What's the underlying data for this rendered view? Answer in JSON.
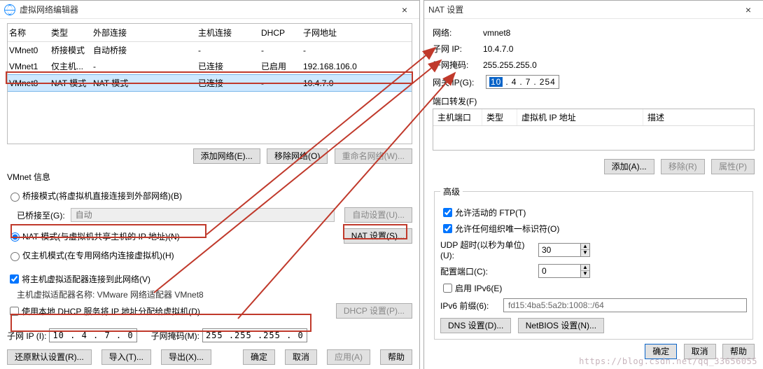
{
  "left": {
    "title": "虚拟网络编辑器",
    "columns": [
      "名称",
      "类型",
      "外部连接",
      "主机连接",
      "DHCP",
      "子网地址"
    ],
    "rows": [
      {
        "name": "VMnet0",
        "type": "桥接模式",
        "ext": "自动桥接",
        "host": "-",
        "dhcp": "-",
        "subnet": "-"
      },
      {
        "name": "VMnet1",
        "type": "仅主机...",
        "ext": "-",
        "host": "已连接",
        "dhcp": "已启用",
        "subnet": "192.168.106.0"
      },
      {
        "name": "VMnet8",
        "type": "NAT 模式",
        "ext": "NAT 模式",
        "host": "已连接",
        "dhcp": "-",
        "subnet": "10.4.7.0"
      }
    ],
    "buttons": {
      "add_net": "添加网络(E)...",
      "remove_net": "移除网络(O)",
      "rename_net": "重命名网络(W)..."
    },
    "info_header": "VMnet 信息",
    "radio_bridge": "桥接模式(将虚拟机直接连接到外部网络)(B)",
    "bridge_to_label": "已桥接至(G):",
    "bridge_to_value": "自动",
    "bridge_auto_btn": "自动设置(U)...",
    "radio_nat": "NAT 模式(与虚拟机共享主机的 IP 地址)(N)",
    "nat_settings_btn": "NAT 设置(S)...",
    "radio_host": "仅主机模式(在专用网络内连接虚拟机)(H)",
    "chk_connect": "将主机虚拟适配器连接到此网络(V)",
    "adapter_label": "主机虚拟适配器名称: VMware 网络适配器 VMnet8",
    "chk_dhcp": "使用本地 DHCP 服务将 IP 地址分配给虚拟机(D)",
    "dhcp_btn": "DHCP 设置(P)...",
    "subnet_ip_label": "子网 IP (I):",
    "subnet_ip": "10 . 4 . 7 . 0",
    "subnet_mask_label": "子网掩码(M):",
    "subnet_mask": "255 .255 .255 . 0",
    "footer": {
      "restore": "还原默认设置(R)...",
      "import": "导入(T)...",
      "export": "导出(X)...",
      "ok": "确定",
      "cancel": "取消",
      "apply": "应用(A)",
      "help": "帮助"
    }
  },
  "right": {
    "title": "NAT 设置",
    "net_label": "网络:",
    "net_val": "vmnet8",
    "sub_ip_label": "子网 IP:",
    "sub_ip_val": "10.4.7.0",
    "mask_label": "子网掩码:",
    "mask_val": "255.255.255.0",
    "gw_label": "网关 IP(G):",
    "gw_oct": [
      "10",
      "4",
      "7",
      "254"
    ],
    "port_fwd_label": "端口转发(F)",
    "pf_cols": {
      "host_port": "主机端口",
      "type": "类型",
      "vm_ip": "虚拟机 IP 地址",
      "desc": "描述"
    },
    "pf_btns": {
      "add": "添加(A)...",
      "remove": "移除(R)",
      "props": "属性(P)"
    },
    "adv_title": "高级",
    "chk_ftp": "允许活动的 FTP(T)",
    "chk_org": "允许任何组织唯一标识符(O)",
    "udp_label": "UDP 超时(以秒为单位)(U):",
    "udp_val": "30",
    "cfg_port_label": "配置端口(C):",
    "cfg_port_val": "0",
    "chk_ipv6": "启用 IPv6(E)",
    "ipv6_prefix_label": "IPv6 前缀(6):",
    "ipv6_prefix_val": "fd15:4ba5:5a2b:1008::/64",
    "dns_btn": "DNS 设置(D)...",
    "netbios_btn": "NetBIOS 设置(N)...",
    "footer": {
      "ok": "确定",
      "cancel": "取消",
      "help": "帮助"
    }
  },
  "watermark": "https://blog.csdn.net/qq_33656055"
}
